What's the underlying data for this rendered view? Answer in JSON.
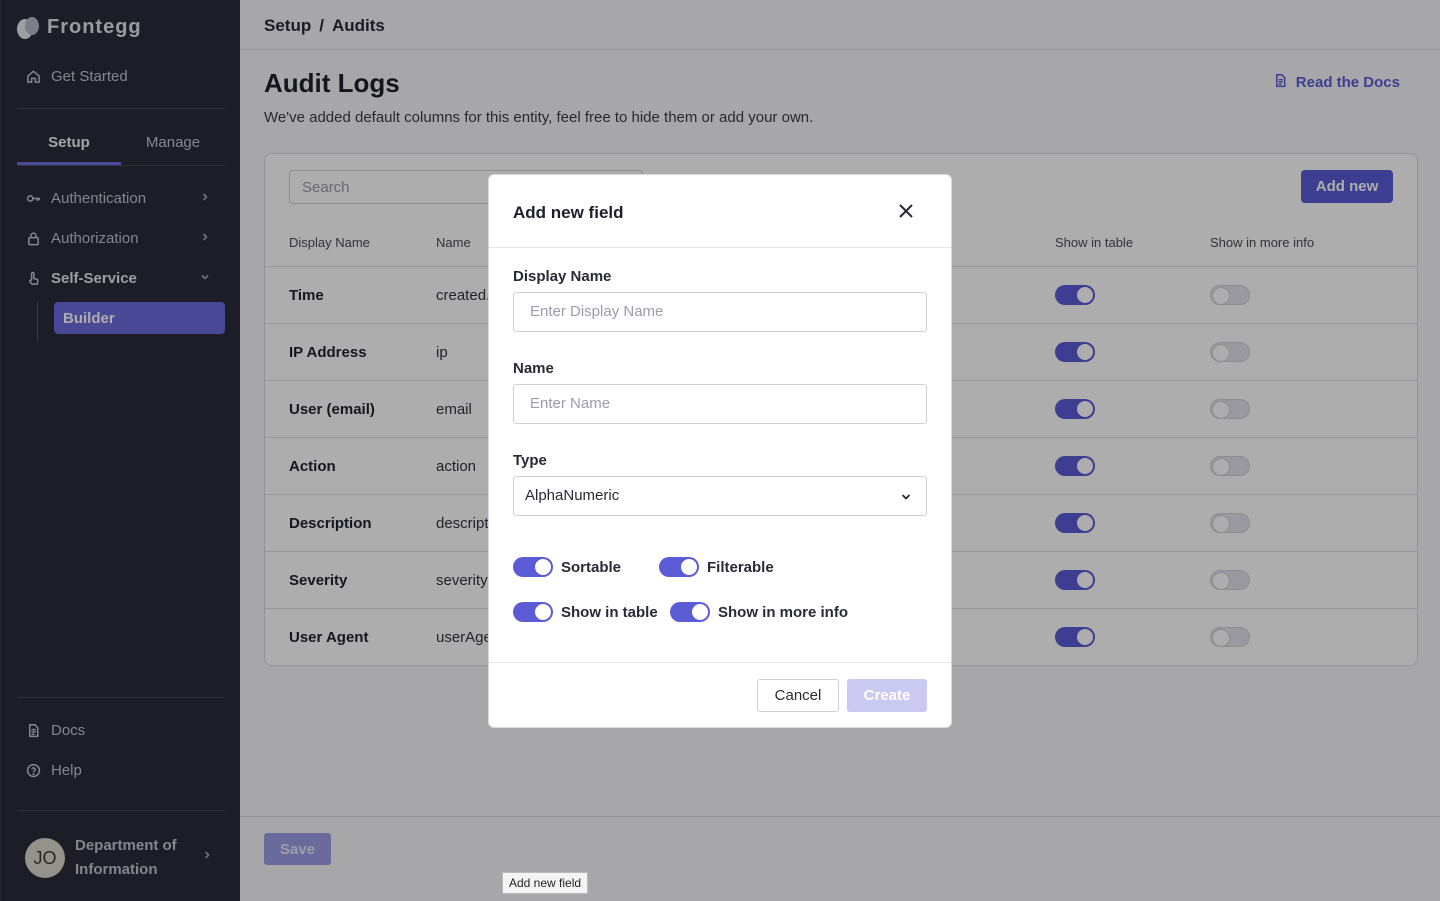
{
  "app": {
    "name": "Frontegg"
  },
  "sidebar": {
    "get_started": "Get Started",
    "tabs": [
      {
        "label": "Setup",
        "active": true
      },
      {
        "label": "Manage",
        "active": false
      }
    ],
    "items": [
      {
        "label": "Authentication",
        "icon": "key-icon"
      },
      {
        "label": "Authorization",
        "icon": "lock-icon"
      },
      {
        "label": "Self-Service",
        "icon": "hand-icon",
        "expanded": true
      }
    ],
    "active_sub_item": "Builder",
    "docs": "Docs",
    "help": "Help",
    "user": {
      "initials": "JO",
      "name": "Department of Information"
    }
  },
  "breadcrumb": {
    "section": "Setup",
    "separator": "/",
    "page": "Audits"
  },
  "page": {
    "title": "Audit Logs",
    "subtitle": "We've added default columns for this entity, feel free to hide them or add your own.",
    "docs_link": "Read the Docs",
    "search_placeholder": "Search",
    "add_new": "Add new",
    "save": "Save"
  },
  "table": {
    "columns": [
      "Display Name",
      "Name",
      "Show in table",
      "Show in more info"
    ],
    "rows": [
      {
        "display_name": "Time",
        "name": "created.",
        "show_in_table": true,
        "show_in_more_info": false
      },
      {
        "display_name": "IP Address",
        "name": "ip",
        "show_in_table": true,
        "show_in_more_info": false
      },
      {
        "display_name": "User (email)",
        "name": "email",
        "show_in_table": true,
        "show_in_more_info": false
      },
      {
        "display_name": "Action",
        "name": "action",
        "show_in_table": true,
        "show_in_more_info": false
      },
      {
        "display_name": "Description",
        "name": "descript",
        "show_in_table": true,
        "show_in_more_info": false
      },
      {
        "display_name": "Severity",
        "name": "severity",
        "show_in_table": true,
        "show_in_more_info": false
      },
      {
        "display_name": "User Agent",
        "name": "userAge",
        "show_in_table": true,
        "show_in_more_info": false
      }
    ]
  },
  "modal": {
    "title": "Add new field",
    "display_name_label": "Display Name",
    "display_name_placeholder": "Enter Display Name",
    "name_label": "Name",
    "name_placeholder": "Enter Name",
    "type_label": "Type",
    "type_value": "AlphaNumeric",
    "toggles": [
      {
        "label": "Sortable",
        "on": true
      },
      {
        "label": "Filterable",
        "on": true
      },
      {
        "label": "Show in table",
        "on": true
      },
      {
        "label": "Show in more info",
        "on": true
      }
    ],
    "cancel": "Cancel",
    "create": "Create"
  },
  "tooltip": "Add new field",
  "colors": {
    "accent": "#5b5bd6",
    "sidebar_bg": "#2b2b3c",
    "create_disabled": "#c9c9f2"
  }
}
